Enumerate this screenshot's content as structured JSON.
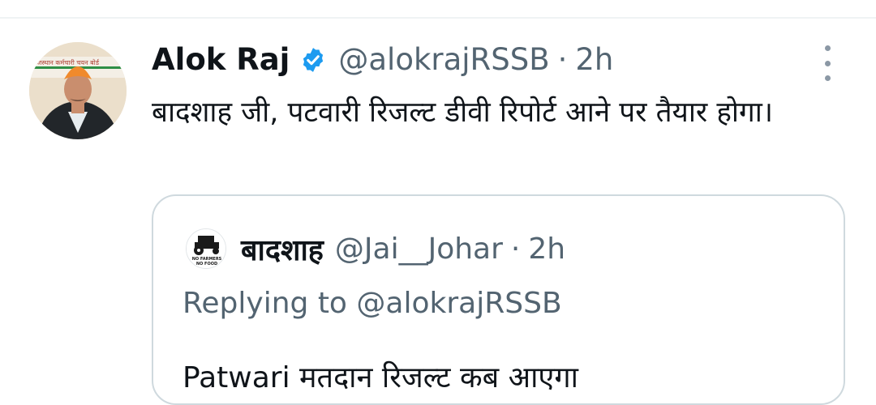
{
  "tweet": {
    "author_name": "Alok Raj",
    "verified_icon": "verified-badge-icon",
    "handle": "@alokrajRSSB",
    "separator": "·",
    "time": "2h",
    "text": "बादशाह जी, पटवारी रिजल्ट डीवी रिपोर्ट आने पर तैयार होगा।",
    "avatar_sign_text": "राजस्थान कर्मचारी चयन बोर्ड",
    "menu_icon": "more-vertical-icon"
  },
  "quote": {
    "author_name": "बादशाह",
    "handle": "@Jai__Johar",
    "separator": "·",
    "time": "2h",
    "avatar_text_line1": "NO FARMERS",
    "avatar_text_line2": "NO FOOD",
    "reply_label": "Replying to",
    "reply_handle": "@alokrajRSSB",
    "text": "Patwari मतदान रिजल्ट कब आएगा"
  },
  "colors": {
    "text_primary": "#0f1419",
    "text_secondary": "#536471",
    "verified_blue": "#1d9bf0",
    "card_border": "#cfd9de"
  }
}
